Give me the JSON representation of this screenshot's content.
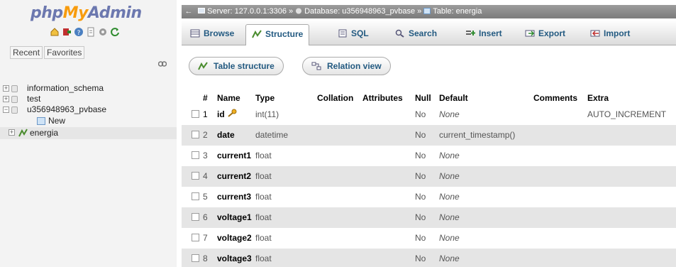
{
  "nav": {
    "logo": {
      "part1": "php",
      "part2": "My",
      "part3": "Admin"
    },
    "icons": [
      "home-icon",
      "exit-icon",
      "help-icon",
      "docs-icon",
      "settings-icon",
      "reload-icon"
    ],
    "recent_tab": "Recent",
    "favorites_tab": "Favorites",
    "link_icon": "chain-link-icon",
    "tree": [
      {
        "label": "information_schema",
        "expander": "+"
      },
      {
        "label": "test",
        "expander": "+"
      },
      {
        "label": "u356948963_pvbase",
        "expander": "−"
      },
      {
        "label": "New"
      },
      {
        "label": "energia",
        "expander": "+"
      }
    ]
  },
  "breadcrumb": {
    "back": "←",
    "server": "Server: 127.0.0.1:3306",
    "database": "Database: u356948963_pvbase",
    "table": "Table: energia",
    "separator": "»"
  },
  "menu": {
    "tabs": [
      {
        "label": "Browse",
        "icon": "browse-icon"
      },
      {
        "label": "Structure",
        "icon": "structure-icon"
      },
      {
        "label": "SQL",
        "icon": "sql-icon"
      },
      {
        "label": "Search",
        "icon": "search-icon"
      },
      {
        "label": "Insert",
        "icon": "insert-icon"
      },
      {
        "label": "Export",
        "icon": "export-icon"
      },
      {
        "label": "Import",
        "icon": "import-icon"
      }
    ]
  },
  "subtabs": {
    "table_structure": "Table structure",
    "relation_view": "Relation view"
  },
  "table": {
    "headers": {
      "num": "#",
      "name": "Name",
      "type": "Type",
      "collation": "Collation",
      "attributes": "Attributes",
      "null": "Null",
      "default": "Default",
      "comments": "Comments",
      "extra": "Extra"
    },
    "rows": [
      {
        "num": "1",
        "name": "id",
        "type": "int(11)",
        "null": "No",
        "default": "None",
        "extra": "AUTO_INCREMENT"
      },
      {
        "num": "2",
        "name": "date",
        "type": "datetime",
        "null": "No",
        "default": "current_timestamp()",
        "extra": ""
      },
      {
        "num": "3",
        "name": "current1",
        "type": "float",
        "null": "No",
        "default": "None",
        "extra": ""
      },
      {
        "num": "4",
        "name": "current2",
        "type": "float",
        "null": "No",
        "default": "None",
        "extra": ""
      },
      {
        "num": "5",
        "name": "current3",
        "type": "float",
        "null": "No",
        "default": "None",
        "extra": ""
      },
      {
        "num": "6",
        "name": "voltage1",
        "type": "float",
        "null": "No",
        "default": "None",
        "extra": ""
      },
      {
        "num": "7",
        "name": "voltage2",
        "type": "float",
        "null": "No",
        "default": "None",
        "extra": ""
      },
      {
        "num": "8",
        "name": "voltage3",
        "type": "float",
        "null": "No",
        "default": "None",
        "extra": ""
      }
    ]
  },
  "colors": {
    "accent": "#235a81",
    "logo_blue": "#6c78af",
    "logo_orange": "#f89c0e",
    "row_alt": "#e5e5e5"
  }
}
